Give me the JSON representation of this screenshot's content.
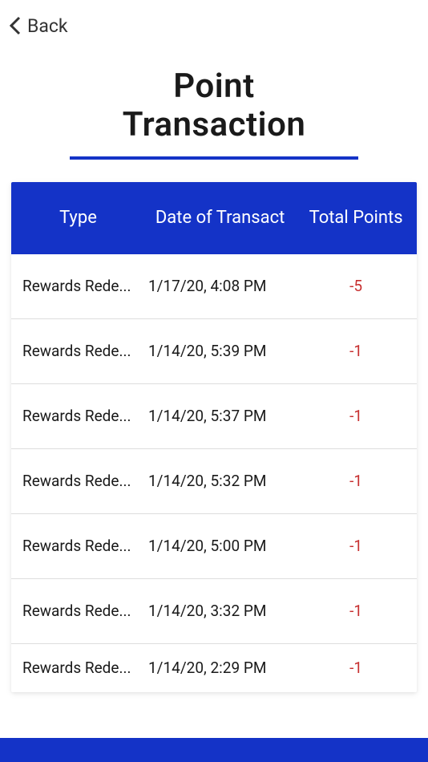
{
  "nav": {
    "back_label": "Back"
  },
  "page": {
    "title_line1": "Point",
    "title_line2": "Transaction"
  },
  "table": {
    "headers": {
      "type": "Type",
      "date": "Date of Transact",
      "points": "Total Points"
    },
    "rows": [
      {
        "type": "Rewards Rede...",
        "date": "1/17/20, 4:08 PM",
        "points": "-5"
      },
      {
        "type": "Rewards Rede...",
        "date": "1/14/20, 5:39 PM",
        "points": "-1"
      },
      {
        "type": "Rewards Rede...",
        "date": "1/14/20, 5:37 PM",
        "points": "-1"
      },
      {
        "type": "Rewards Rede...",
        "date": "1/14/20, 5:32 PM",
        "points": "-1"
      },
      {
        "type": "Rewards Rede...",
        "date": "1/14/20, 5:00 PM",
        "points": "-1"
      },
      {
        "type": "Rewards Rede...",
        "date": "1/14/20, 3:32 PM",
        "points": "-1"
      },
      {
        "type": "Rewards Rede...",
        "date": "1/14/20, 2:29 PM",
        "points": "-1"
      }
    ]
  },
  "colors": {
    "accent": "#1433c7",
    "negative": "#c73030"
  }
}
